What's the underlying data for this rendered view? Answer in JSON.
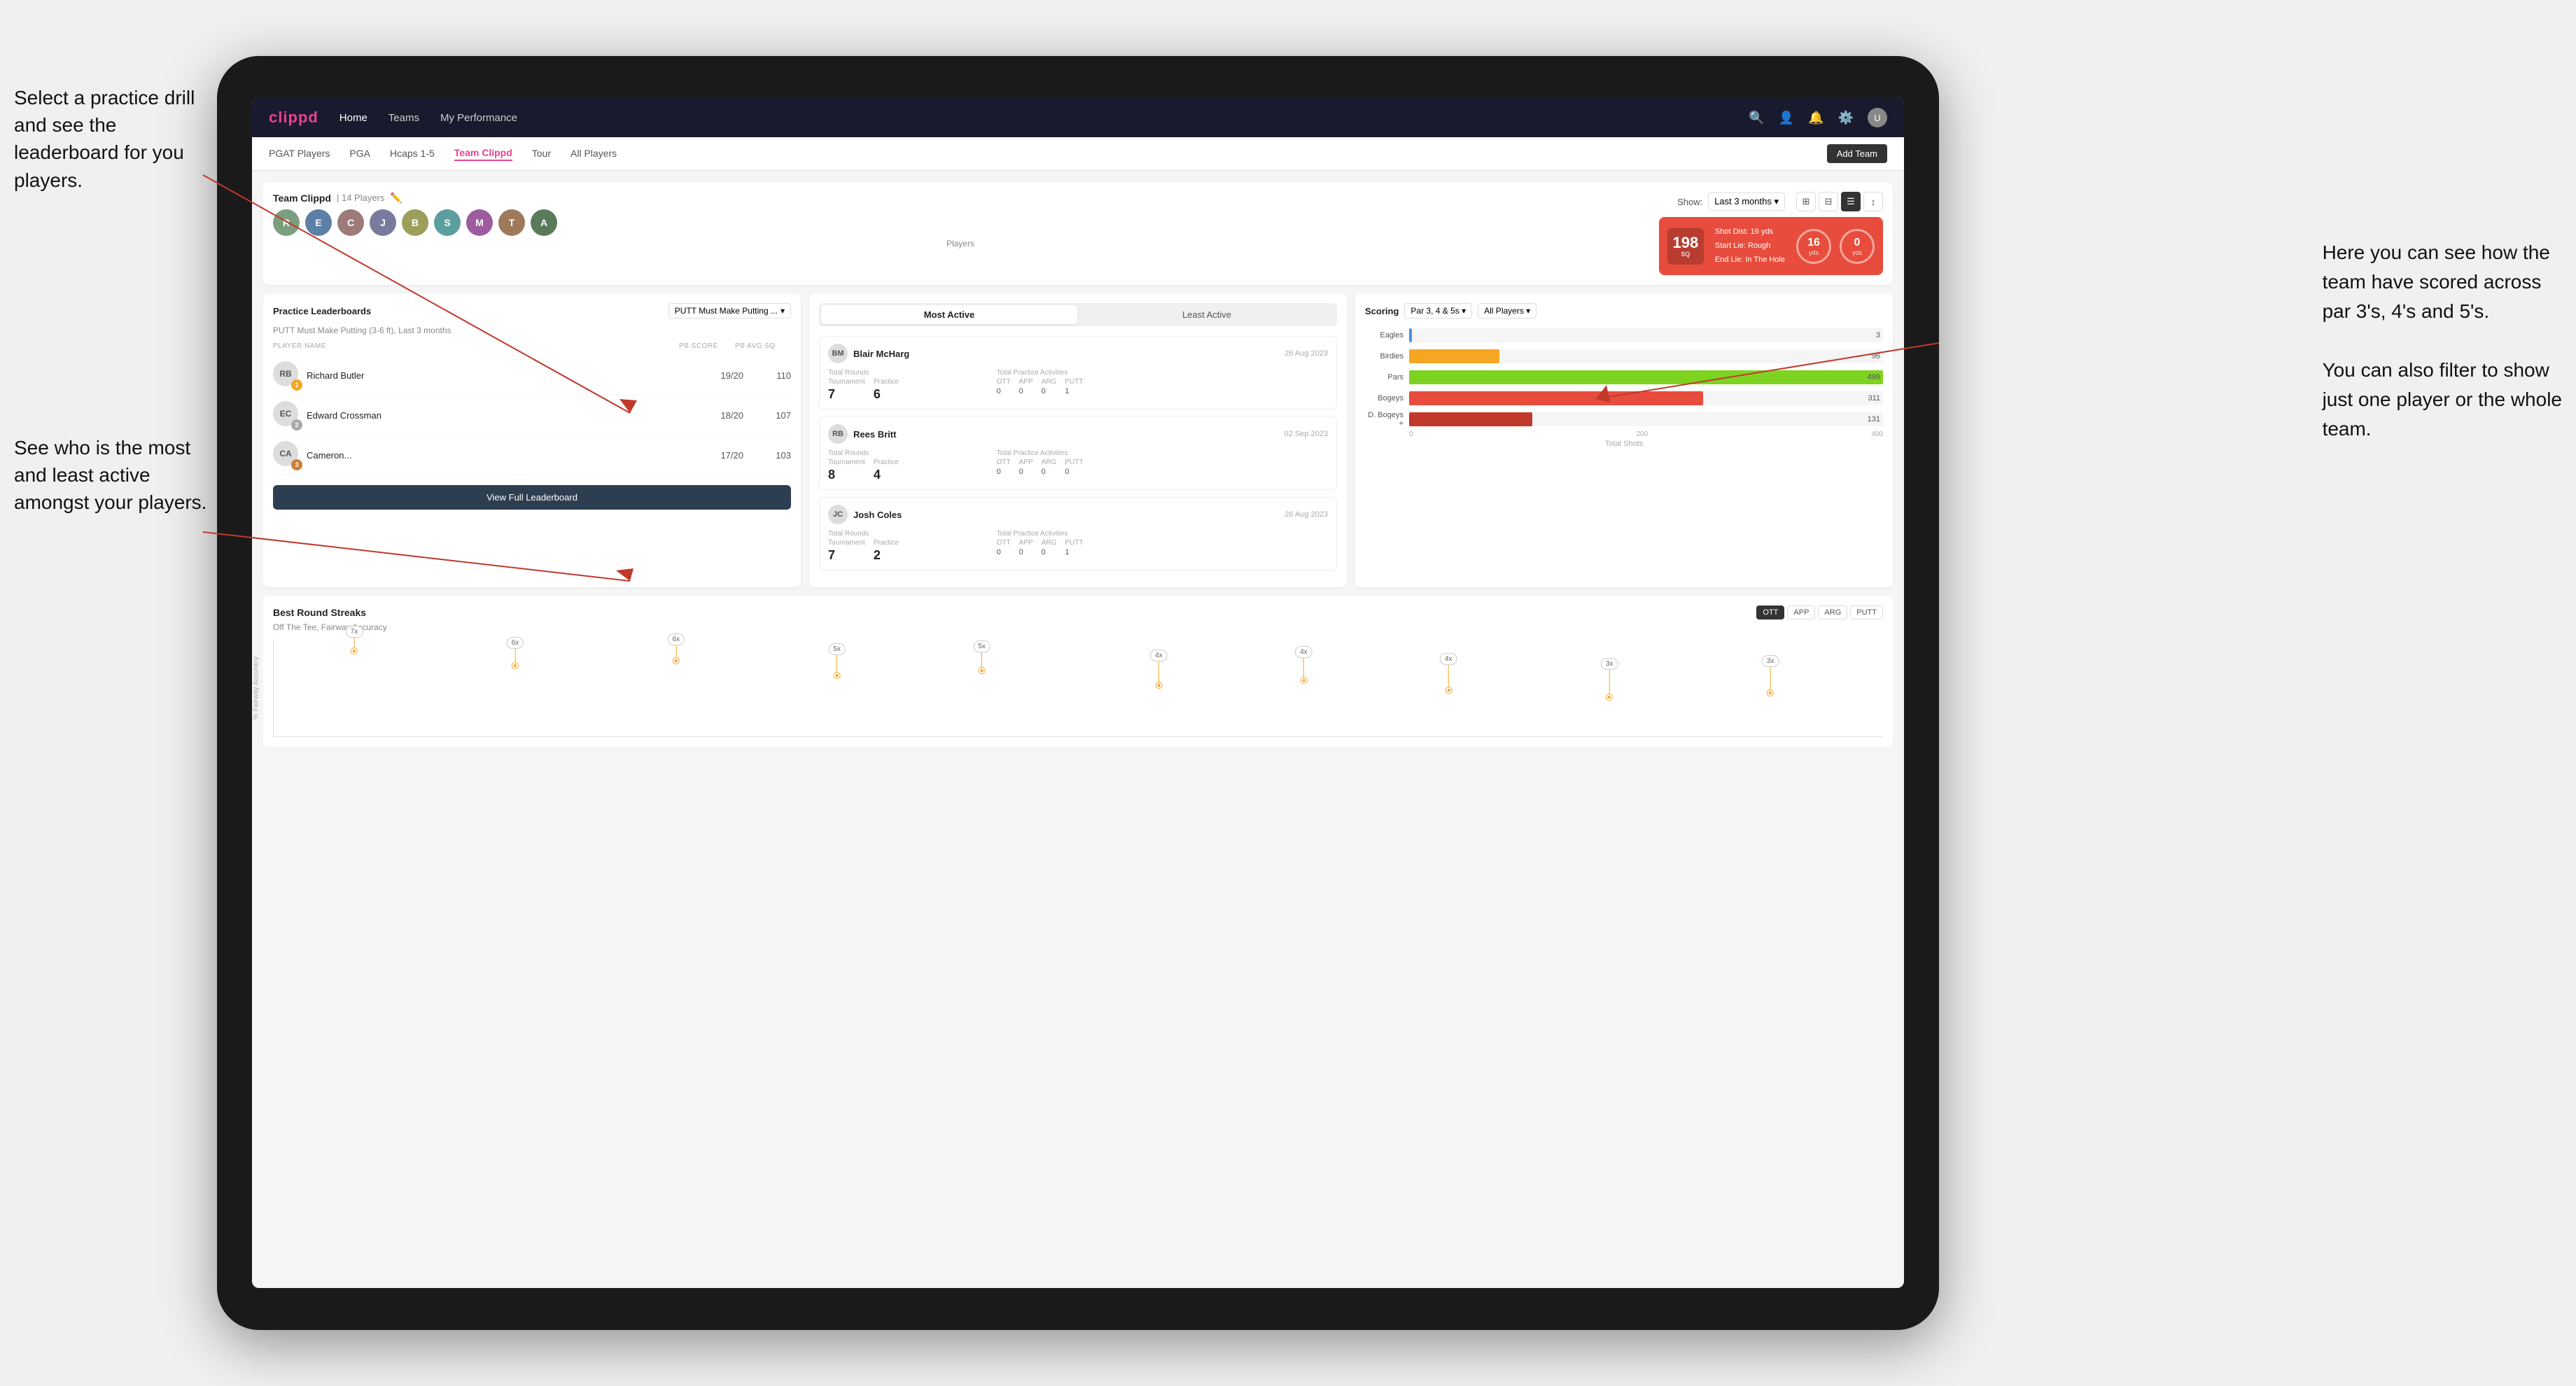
{
  "annotations": {
    "top_left": "Select a practice drill and see\nthe leaderboard for you players.",
    "bottom_left": "See who is the most and least\nactive amongst your players.",
    "top_right_line1": "Here you can see how the",
    "top_right_line2": "team have scored across",
    "top_right_line3": "par 3's, 4's and 5's.",
    "bottom_right_line1": "You can also filter to show",
    "bottom_right_line2": "just one player or the whole",
    "bottom_right_line3": "team."
  },
  "nav": {
    "logo": "clippd",
    "items": [
      "Home",
      "Teams",
      "My Performance"
    ],
    "icons": [
      "search",
      "person",
      "bell",
      "settings",
      "avatar"
    ]
  },
  "sub_nav": {
    "items": [
      "PGAT Players",
      "PGA",
      "Hcaps 1-5",
      "Team Clippd",
      "Tour",
      "All Players"
    ],
    "active": "Team Clippd",
    "add_team_btn": "Add Team"
  },
  "team_header": {
    "title": "Team Clippd",
    "player_count": "14 Players",
    "players_label": "Players",
    "show_label": "Show:",
    "show_value": "Last 3 months",
    "view_options": [
      "grid-2",
      "grid-3",
      "list",
      "sort"
    ]
  },
  "shot_card": {
    "badge_num": "198",
    "badge_sub": "SQ",
    "shot_dist_label": "Shot Dist: 16 yds",
    "start_lie_label": "Start Lie: Rough",
    "end_lie_label": "End Lie: In The Hole",
    "circle1_val": "16",
    "circle1_unit": "yds",
    "circle2_val": "0",
    "circle2_unit": "yds"
  },
  "practice_leaderboards": {
    "card_title": "Practice Leaderboards",
    "drill_select": "PUTT Must Make Putting ...",
    "drill_subtitle": "PUTT Must Make Putting (3-6 ft), Last 3 months",
    "table_headers": {
      "player_name": "PLAYER NAME",
      "pb_score": "PB SCORE",
      "pb_avg_sq": "PB AVG SQ"
    },
    "players": [
      {
        "name": "Richard Butler",
        "rank": 1,
        "rank_color": "gold",
        "score": "19/20",
        "avg": "110"
      },
      {
        "name": "Edward Crossman",
        "rank": 2,
        "rank_color": "silver",
        "score": "18/20",
        "avg": "107"
      },
      {
        "name": "Cameron...",
        "rank": 3,
        "rank_color": "bronze",
        "score": "17/20",
        "avg": "103"
      }
    ],
    "view_full_btn": "View Full Leaderboard"
  },
  "activity": {
    "tab_active": "Most Active",
    "tab_inactive": "Least Active",
    "players": [
      {
        "name": "Blair McHarg",
        "date": "26 Aug 2023",
        "total_rounds_label": "Total Rounds",
        "tournament_label": "Tournament",
        "practice_label": "Practice",
        "tournament_val": "7",
        "practice_val": "6",
        "total_practice_label": "Total Practice Activities",
        "ott_label": "OTT",
        "app_label": "APP",
        "arg_label": "ARG",
        "putt_label": "PUTT",
        "ott_val": "0",
        "app_val": "0",
        "arg_val": "0",
        "putt_val": "1"
      },
      {
        "name": "Rees Britt",
        "date": "02 Sep 2023",
        "tournament_val": "8",
        "practice_val": "4",
        "ott_val": "0",
        "app_val": "0",
        "arg_val": "0",
        "putt_val": "0"
      },
      {
        "name": "Josh Coles",
        "date": "26 Aug 2023",
        "tournament_val": "7",
        "practice_val": "2",
        "ott_val": "0",
        "app_val": "0",
        "arg_val": "0",
        "putt_val": "1"
      }
    ]
  },
  "scoring": {
    "title": "Scoring",
    "filter1": "Par 3, 4 & 5s",
    "filter2": "All Players",
    "bars": [
      {
        "label": "Eagles",
        "value": 3,
        "max": 499,
        "color": "eagles"
      },
      {
        "label": "Birdies",
        "value": 96,
        "max": 499,
        "color": "birdies"
      },
      {
        "label": "Pars",
        "value": 499,
        "max": 499,
        "color": "pars"
      },
      {
        "label": "Bogeys",
        "value": 311,
        "max": 499,
        "color": "bogeys"
      },
      {
        "label": "D.Bogeys +",
        "value": 131,
        "max": 499,
        "color": "dbogeys"
      }
    ],
    "x_labels": [
      "0",
      "200",
      "400"
    ],
    "x_title": "Total Shots"
  },
  "streaks": {
    "title": "Best Round Streaks",
    "subtitle": "Off The Tee, Fairway Accuracy",
    "filter_btns": [
      "OTT",
      "APP",
      "ARG",
      "PUTT"
    ],
    "active_filter": "OTT",
    "pins": [
      {
        "label": "7x",
        "left_pct": 5
      },
      {
        "label": "6x",
        "left_pct": 15
      },
      {
        "label": "6x",
        "left_pct": 25
      },
      {
        "label": "5x",
        "left_pct": 35
      },
      {
        "label": "5x",
        "left_pct": 43
      },
      {
        "label": "4x",
        "left_pct": 54
      },
      {
        "label": "4x",
        "left_pct": 63
      },
      {
        "label": "4x",
        "left_pct": 72
      },
      {
        "label": "3x",
        "left_pct": 83
      },
      {
        "label": "3x",
        "left_pct": 92
      }
    ]
  }
}
